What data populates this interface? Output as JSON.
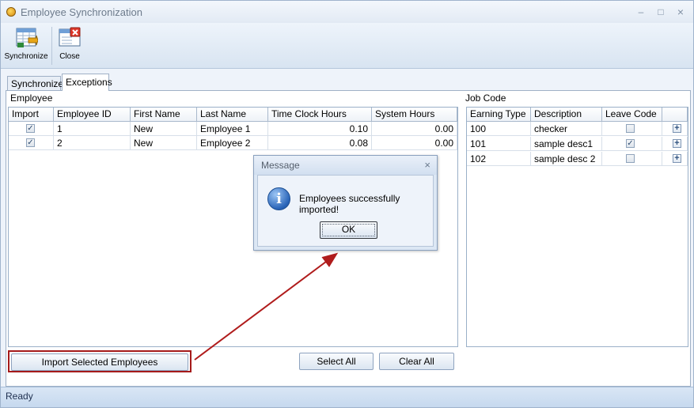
{
  "window": {
    "title": "Employee Synchronization",
    "minimize": "–",
    "maximize": "□",
    "close": "×"
  },
  "toolbar": {
    "synchronize_label": "Synchronize",
    "close_label": "Close"
  },
  "tabs": [
    {
      "label": "Synchronize",
      "active": false
    },
    {
      "label": "Exceptions",
      "active": true
    }
  ],
  "employee": {
    "label": "Employee",
    "columns": [
      "Import",
      "Employee ID",
      "First Name",
      "Last Name",
      "Time Clock Hours",
      "System Hours"
    ],
    "rows": [
      {
        "import": true,
        "id": "1",
        "first": "New",
        "last": "Employee 1",
        "tc_hours": "0.10",
        "sys_hours": "0.00"
      },
      {
        "import": true,
        "id": "2",
        "first": "New",
        "last": "Employee 2",
        "tc_hours": "0.08",
        "sys_hours": "0.00"
      }
    ]
  },
  "job_code": {
    "label": "Job Code",
    "columns": [
      "Earning Type",
      "Description",
      "Leave Code",
      ""
    ],
    "rows": [
      {
        "earning_type": "100",
        "description": "checker",
        "leave_code": false
      },
      {
        "earning_type": "101",
        "description": "sample desc1",
        "leave_code": true
      },
      {
        "earning_type": "102",
        "description": "sample desc 2",
        "leave_code": false
      }
    ],
    "expand_symbol": "+"
  },
  "buttons": {
    "import_selected": "Import Selected Employees",
    "select_all": "Select All",
    "clear_all": "Clear All"
  },
  "dialog": {
    "title": "Message",
    "close": "×",
    "icon_glyph": "i",
    "message": "Employees successfully imported!",
    "ok": "OK"
  },
  "status": {
    "text": "Ready"
  },
  "colors": {
    "highlight": "#a51a1a",
    "arrow": "#b01c1c",
    "window_bg": "#dfe9f5"
  },
  "icons": [
    "app-icon",
    "synchronize-icon",
    "close-icon",
    "info-icon",
    "plus-icon",
    "checkbox-icon"
  ]
}
